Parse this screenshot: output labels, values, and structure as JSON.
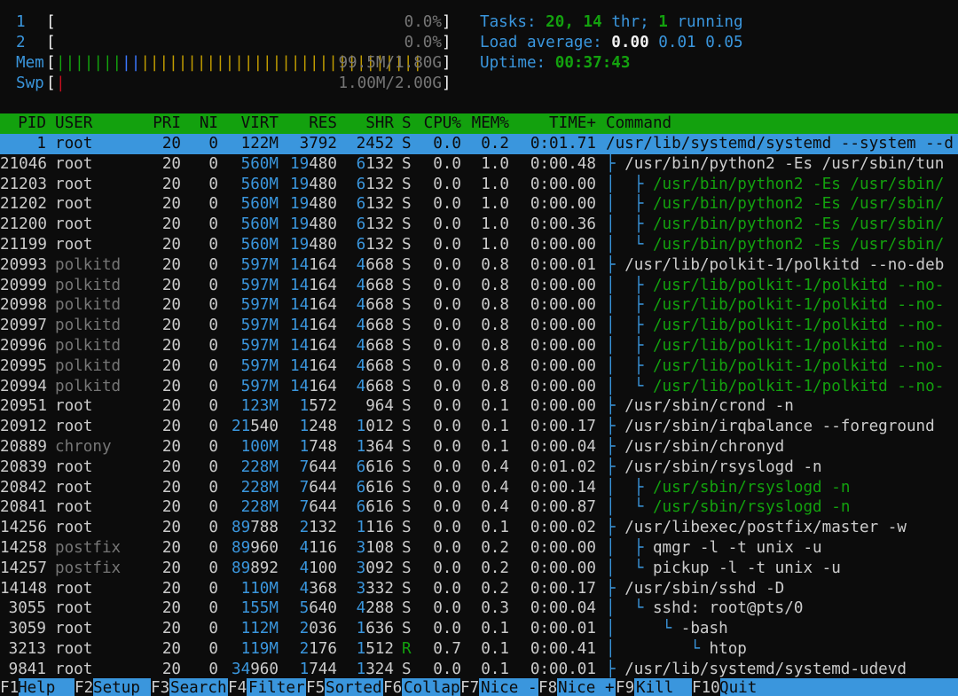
{
  "meters": {
    "cpu": [
      {
        "label": "1",
        "value": "0.0%"
      },
      {
        "label": "2",
        "value": "0.0%"
      }
    ],
    "mem": {
      "label": "Mem",
      "value": "99.5M/1.80G",
      "used": 7,
      "buffers": 2,
      "cache": 30
    },
    "swp": {
      "label": "Swp",
      "value": "1.00M/2.00G"
    }
  },
  "summary": {
    "tasks_label": "Tasks:",
    "tasks": "20,",
    "threads": "14",
    "thr_label": "thr;",
    "running": "1",
    "running_label": "running",
    "load_label": "Load average:",
    "load1": "0.00",
    "load5": "0.01",
    "load15": "0.05",
    "uptime_label": "Uptime:",
    "uptime": "00:37:43"
  },
  "columns": [
    "PID",
    "USER",
    "PRI",
    "NI",
    "VIRT",
    "RES",
    "SHR",
    "S",
    "CPU%",
    "MEM%",
    "TIME+",
    "Command"
  ],
  "processes": [
    {
      "pid": "1",
      "user": "root",
      "pri": "20",
      "ni": "0",
      "virt": "122M",
      "res": "3792",
      "shr": "2452",
      "s": "S",
      "cpu": "0.0",
      "mem": "0.2",
      "time": "0:01.71",
      "tree": "",
      "cmd": "/usr/lib/systemd/systemd --system --d",
      "selected": true
    },
    {
      "pid": "21046",
      "user": "root",
      "pri": "20",
      "ni": "0",
      "virt": "560M",
      "res": "19480",
      "shr": "6132",
      "s": "S",
      "cpu": "0.0",
      "mem": "1.0",
      "time": "0:00.48",
      "tree": "├ ",
      "cmd": "/usr/bin/python2 -Es /usr/sbin/tun"
    },
    {
      "pid": "21203",
      "user": "root",
      "pri": "20",
      "ni": "0",
      "virt": "560M",
      "res": "19480",
      "shr": "6132",
      "s": "S",
      "cpu": "0.0",
      "mem": "1.0",
      "time": "0:00.00",
      "tree": "│  ├ ",
      "cmd": "/usr/bin/python2 -Es /usr/sbin/",
      "thread": true
    },
    {
      "pid": "21202",
      "user": "root",
      "pri": "20",
      "ni": "0",
      "virt": "560M",
      "res": "19480",
      "shr": "6132",
      "s": "S",
      "cpu": "0.0",
      "mem": "1.0",
      "time": "0:00.00",
      "tree": "│  ├ ",
      "cmd": "/usr/bin/python2 -Es /usr/sbin/",
      "thread": true
    },
    {
      "pid": "21200",
      "user": "root",
      "pri": "20",
      "ni": "0",
      "virt": "560M",
      "res": "19480",
      "shr": "6132",
      "s": "S",
      "cpu": "0.0",
      "mem": "1.0",
      "time": "0:00.36",
      "tree": "│  ├ ",
      "cmd": "/usr/bin/python2 -Es /usr/sbin/",
      "thread": true
    },
    {
      "pid": "21199",
      "user": "root",
      "pri": "20",
      "ni": "0",
      "virt": "560M",
      "res": "19480",
      "shr": "6132",
      "s": "S",
      "cpu": "0.0",
      "mem": "1.0",
      "time": "0:00.00",
      "tree": "│  └ ",
      "cmd": "/usr/bin/python2 -Es /usr/sbin/",
      "thread": true
    },
    {
      "pid": "20993",
      "user": "polkitd",
      "pri": "20",
      "ni": "0",
      "virt": "597M",
      "res": "14164",
      "shr": "4668",
      "s": "S",
      "cpu": "0.0",
      "mem": "0.8",
      "time": "0:00.01",
      "tree": "├ ",
      "cmd": "/usr/lib/polkit-1/polkitd --no-deb"
    },
    {
      "pid": "20999",
      "user": "polkitd",
      "pri": "20",
      "ni": "0",
      "virt": "597M",
      "res": "14164",
      "shr": "4668",
      "s": "S",
      "cpu": "0.0",
      "mem": "0.8",
      "time": "0:00.00",
      "tree": "│  ├ ",
      "cmd": "/usr/lib/polkit-1/polkitd --no-",
      "thread": true
    },
    {
      "pid": "20998",
      "user": "polkitd",
      "pri": "20",
      "ni": "0",
      "virt": "597M",
      "res": "14164",
      "shr": "4668",
      "s": "S",
      "cpu": "0.0",
      "mem": "0.8",
      "time": "0:00.00",
      "tree": "│  ├ ",
      "cmd": "/usr/lib/polkit-1/polkitd --no-",
      "thread": true
    },
    {
      "pid": "20997",
      "user": "polkitd",
      "pri": "20",
      "ni": "0",
      "virt": "597M",
      "res": "14164",
      "shr": "4668",
      "s": "S",
      "cpu": "0.0",
      "mem": "0.8",
      "time": "0:00.00",
      "tree": "│  ├ ",
      "cmd": "/usr/lib/polkit-1/polkitd --no-",
      "thread": true
    },
    {
      "pid": "20996",
      "user": "polkitd",
      "pri": "20",
      "ni": "0",
      "virt": "597M",
      "res": "14164",
      "shr": "4668",
      "s": "S",
      "cpu": "0.0",
      "mem": "0.8",
      "time": "0:00.00",
      "tree": "│  ├ ",
      "cmd": "/usr/lib/polkit-1/polkitd --no-",
      "thread": true
    },
    {
      "pid": "20995",
      "user": "polkitd",
      "pri": "20",
      "ni": "0",
      "virt": "597M",
      "res": "14164",
      "shr": "4668",
      "s": "S",
      "cpu": "0.0",
      "mem": "0.8",
      "time": "0:00.00",
      "tree": "│  ├ ",
      "cmd": "/usr/lib/polkit-1/polkitd --no-",
      "thread": true
    },
    {
      "pid": "20994",
      "user": "polkitd",
      "pri": "20",
      "ni": "0",
      "virt": "597M",
      "res": "14164",
      "shr": "4668",
      "s": "S",
      "cpu": "0.0",
      "mem": "0.8",
      "time": "0:00.00",
      "tree": "│  └ ",
      "cmd": "/usr/lib/polkit-1/polkitd --no-",
      "thread": true
    },
    {
      "pid": "20951",
      "user": "root",
      "pri": "20",
      "ni": "0",
      "virt": "123M",
      "res": "1572",
      "shr": "964",
      "s": "S",
      "cpu": "0.0",
      "mem": "0.1",
      "time": "0:00.00",
      "tree": "├ ",
      "cmd": "/usr/sbin/crond -n"
    },
    {
      "pid": "20912",
      "user": "root",
      "pri": "20",
      "ni": "0",
      "virt": "21540",
      "res": "1248",
      "shr": "1012",
      "s": "S",
      "cpu": "0.0",
      "mem": "0.1",
      "time": "0:00.17",
      "tree": "├ ",
      "cmd": "/usr/sbin/irqbalance --foreground"
    },
    {
      "pid": "20889",
      "user": "chrony",
      "pri": "20",
      "ni": "0",
      "virt": "100M",
      "res": "1748",
      "shr": "1364",
      "s": "S",
      "cpu": "0.0",
      "mem": "0.1",
      "time": "0:00.04",
      "tree": "├ ",
      "cmd": "/usr/sbin/chronyd"
    },
    {
      "pid": "20839",
      "user": "root",
      "pri": "20",
      "ni": "0",
      "virt": "228M",
      "res": "7644",
      "shr": "6616",
      "s": "S",
      "cpu": "0.0",
      "mem": "0.4",
      "time": "0:01.02",
      "tree": "├ ",
      "cmd": "/usr/sbin/rsyslogd -n"
    },
    {
      "pid": "20842",
      "user": "root",
      "pri": "20",
      "ni": "0",
      "virt": "228M",
      "res": "7644",
      "shr": "6616",
      "s": "S",
      "cpu": "0.0",
      "mem": "0.4",
      "time": "0:00.14",
      "tree": "│  ├ ",
      "cmd": "/usr/sbin/rsyslogd -n",
      "thread": true
    },
    {
      "pid": "20841",
      "user": "root",
      "pri": "20",
      "ni": "0",
      "virt": "228M",
      "res": "7644",
      "shr": "6616",
      "s": "S",
      "cpu": "0.0",
      "mem": "0.4",
      "time": "0:00.87",
      "tree": "│  └ ",
      "cmd": "/usr/sbin/rsyslogd -n",
      "thread": true
    },
    {
      "pid": "14256",
      "user": "root",
      "pri": "20",
      "ni": "0",
      "virt": "89788",
      "res": "2132",
      "shr": "1116",
      "s": "S",
      "cpu": "0.0",
      "mem": "0.1",
      "time": "0:00.02",
      "tree": "├ ",
      "cmd": "/usr/libexec/postfix/master -w"
    },
    {
      "pid": "14258",
      "user": "postfix",
      "pri": "20",
      "ni": "0",
      "virt": "89960",
      "res": "4116",
      "shr": "3108",
      "s": "S",
      "cpu": "0.0",
      "mem": "0.2",
      "time": "0:00.00",
      "tree": "│  ├ ",
      "cmd": "qmgr -l -t unix -u"
    },
    {
      "pid": "14257",
      "user": "postfix",
      "pri": "20",
      "ni": "0",
      "virt": "89892",
      "res": "4100",
      "shr": "3092",
      "s": "S",
      "cpu": "0.0",
      "mem": "0.2",
      "time": "0:00.00",
      "tree": "│  └ ",
      "cmd": "pickup -l -t unix -u"
    },
    {
      "pid": "14148",
      "user": "root",
      "pri": "20",
      "ni": "0",
      "virt": "110M",
      "res": "4368",
      "shr": "3332",
      "s": "S",
      "cpu": "0.0",
      "mem": "0.2",
      "time": "0:00.17",
      "tree": "├ ",
      "cmd": "/usr/sbin/sshd -D"
    },
    {
      "pid": "3055",
      "user": "root",
      "pri": "20",
      "ni": "0",
      "virt": "155M",
      "res": "5640",
      "shr": "4288",
      "s": "S",
      "cpu": "0.0",
      "mem": "0.3",
      "time": "0:00.04",
      "tree": "│  └ ",
      "cmd": "sshd: root@pts/0"
    },
    {
      "pid": "3059",
      "user": "root",
      "pri": "20",
      "ni": "0",
      "virt": "112M",
      "res": "2036",
      "shr": "1636",
      "s": "S",
      "cpu": "0.0",
      "mem": "0.1",
      "time": "0:00.01",
      "tree": "│     └ ",
      "cmd": "-bash"
    },
    {
      "pid": "3213",
      "user": "root",
      "pri": "20",
      "ni": "0",
      "virt": "119M",
      "res": "2176",
      "shr": "1512",
      "s": "R",
      "cpu": "0.7",
      "mem": "0.1",
      "time": "0:00.41",
      "tree": "│        └ ",
      "cmd": "htop"
    },
    {
      "pid": "9841",
      "user": "root",
      "pri": "20",
      "ni": "0",
      "virt": "34960",
      "res": "1744",
      "shr": "1324",
      "s": "S",
      "cpu": "0.0",
      "mem": "0.1",
      "time": "0:00.01",
      "tree": "├ ",
      "cmd": "/usr/lib/systemd/systemd-udevd"
    }
  ],
  "function_keys": [
    {
      "key": "F1",
      "label": "Help"
    },
    {
      "key": "F2",
      "label": "Setup"
    },
    {
      "key": "F3",
      "label": "Search"
    },
    {
      "key": "F4",
      "label": "Filter"
    },
    {
      "key": "F5",
      "label": "Sorted"
    },
    {
      "key": "F6",
      "label": "Collap"
    },
    {
      "key": "F7",
      "label": "Nice -"
    },
    {
      "key": "F8",
      "label": "Nice +"
    },
    {
      "key": "F9",
      "label": "Kill"
    },
    {
      "key": "F10",
      "label": "Quit"
    }
  ],
  "colors": {
    "background": "#0c0c0c",
    "header_bg": "#13a10e",
    "selection_bg": "#3a96dd",
    "cyan": "#3a96dd",
    "green": "#13a10e",
    "grey": "#767676",
    "blue": "#3b78ff",
    "gold": "#c19c00",
    "red": "#c50f1f"
  }
}
